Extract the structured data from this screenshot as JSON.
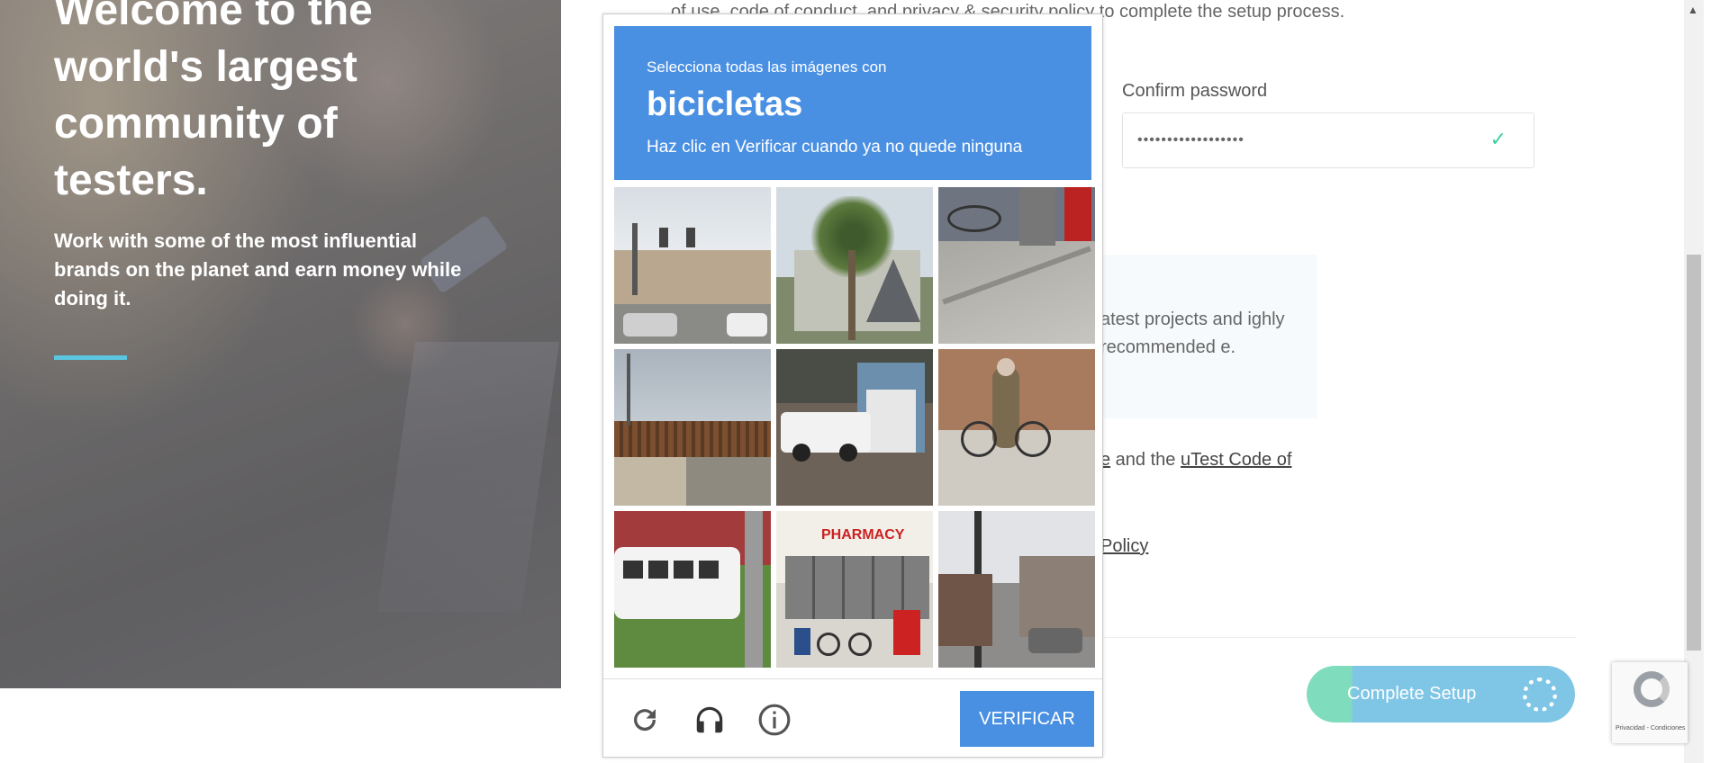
{
  "hero": {
    "title": "Welcome to the world's largest community of testers.",
    "subtitle": "Work with some of the most influential brands on the planet and earn money while doing it."
  },
  "form": {
    "terms_line": "of use, code of conduct, and privacy & security policy to complete the setup process.",
    "confirm_password_label": "Confirm password",
    "confirm_password_value": "••••••••••••••••••",
    "info_text": "atest projects and ighly recommended e.",
    "agree_prefix": "e",
    "agree_middle": " and the ",
    "agree_link": "uTest Code of",
    "policy_link": " Policy",
    "complete_button": "Complete Setup"
  },
  "recaptcha_badge": {
    "text": "Privacidad - Condiciones"
  },
  "captcha": {
    "prompt": "Selecciona todas las imágenes con",
    "object": "bicicletas",
    "instruction": "Haz clic en Verificar cuando ya no quede ninguna",
    "verify_label": "VERIFICAR",
    "tiles": [
      {
        "scene": "street-traffic-lights"
      },
      {
        "scene": "palm-tree-house"
      },
      {
        "scene": "sidewalk-bikes"
      },
      {
        "scene": "bridge-sky"
      },
      {
        "scene": "pickup-garage"
      },
      {
        "scene": "man-with-bicycle"
      },
      {
        "scene": "white-van"
      },
      {
        "scene": "pharmacy-bicycle",
        "sign": "PHARMACY"
      },
      {
        "scene": "city-street-pole"
      }
    ],
    "icons": {
      "reload": "reload-icon",
      "audio": "headphones-icon",
      "info": "info-icon"
    }
  },
  "colors": {
    "captcha_blue": "#4a90e2",
    "accent_teal": "#5bc6e0",
    "check_green": "#3ccfa0"
  }
}
